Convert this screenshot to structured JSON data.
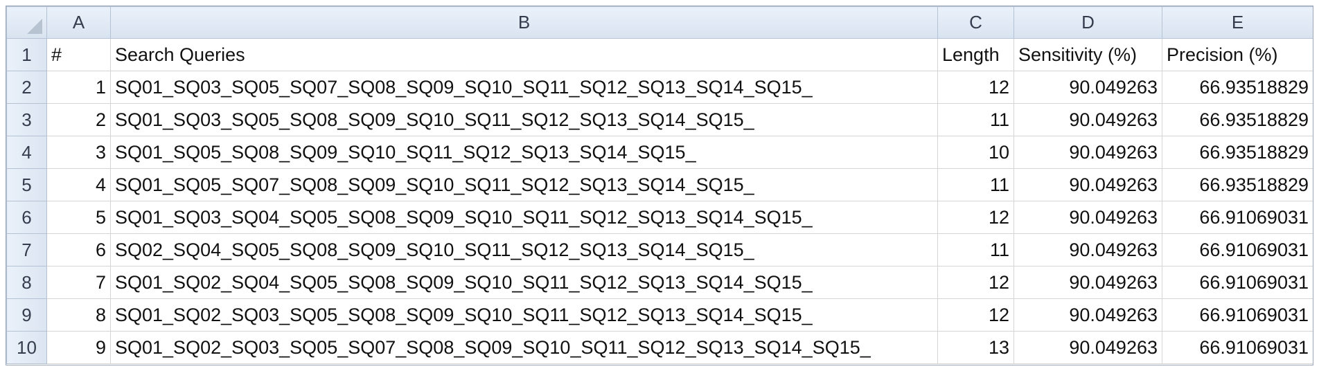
{
  "columns": [
    "A",
    "B",
    "C",
    "D",
    "E"
  ],
  "header_row": {
    "row_number": "1",
    "a": "#",
    "b": "Search Queries",
    "c": "Length",
    "d": "Sensitivity (%)",
    "e": "Precision (%)"
  },
  "rows": [
    {
      "row_number": "2",
      "a": "1",
      "b": "SQ01_SQ03_SQ05_SQ07_SQ08_SQ09_SQ10_SQ11_SQ12_SQ13_SQ14_SQ15_",
      "c": "12",
      "d": "90.049263",
      "e": "66.93518829"
    },
    {
      "row_number": "3",
      "a": "2",
      "b": "SQ01_SQ03_SQ05_SQ08_SQ09_SQ10_SQ11_SQ12_SQ13_SQ14_SQ15_",
      "c": "11",
      "d": "90.049263",
      "e": "66.93518829"
    },
    {
      "row_number": "4",
      "a": "3",
      "b": "SQ01_SQ05_SQ08_SQ09_SQ10_SQ11_SQ12_SQ13_SQ14_SQ15_",
      "c": "10",
      "d": "90.049263",
      "e": "66.93518829"
    },
    {
      "row_number": "5",
      "a": "4",
      "b": "SQ01_SQ05_SQ07_SQ08_SQ09_SQ10_SQ11_SQ12_SQ13_SQ14_SQ15_",
      "c": "11",
      "d": "90.049263",
      "e": "66.93518829"
    },
    {
      "row_number": "6",
      "a": "5",
      "b": "SQ01_SQ03_SQ04_SQ05_SQ08_SQ09_SQ10_SQ11_SQ12_SQ13_SQ14_SQ15_",
      "c": "12",
      "d": "90.049263",
      "e": "66.91069031"
    },
    {
      "row_number": "7",
      "a": "6",
      "b": "SQ02_SQ04_SQ05_SQ08_SQ09_SQ10_SQ11_SQ12_SQ13_SQ14_SQ15_",
      "c": "11",
      "d": "90.049263",
      "e": "66.91069031"
    },
    {
      "row_number": "8",
      "a": "7",
      "b": "SQ01_SQ02_SQ04_SQ05_SQ08_SQ09_SQ10_SQ11_SQ12_SQ13_SQ14_SQ15_",
      "c": "12",
      "d": "90.049263",
      "e": "66.91069031"
    },
    {
      "row_number": "9",
      "a": "8",
      "b": "SQ01_SQ02_SQ03_SQ05_SQ08_SQ09_SQ10_SQ11_SQ12_SQ13_SQ14_SQ15_",
      "c": "12",
      "d": "90.049263",
      "e": "66.91069031"
    },
    {
      "row_number": "10",
      "a": "9",
      "b": "SQ01_SQ02_SQ03_SQ05_SQ07_SQ08_SQ09_SQ10_SQ11_SQ12_SQ13_SQ14_SQ15_",
      "c": "13",
      "d": "90.049263",
      "e": "66.91069031"
    }
  ]
}
